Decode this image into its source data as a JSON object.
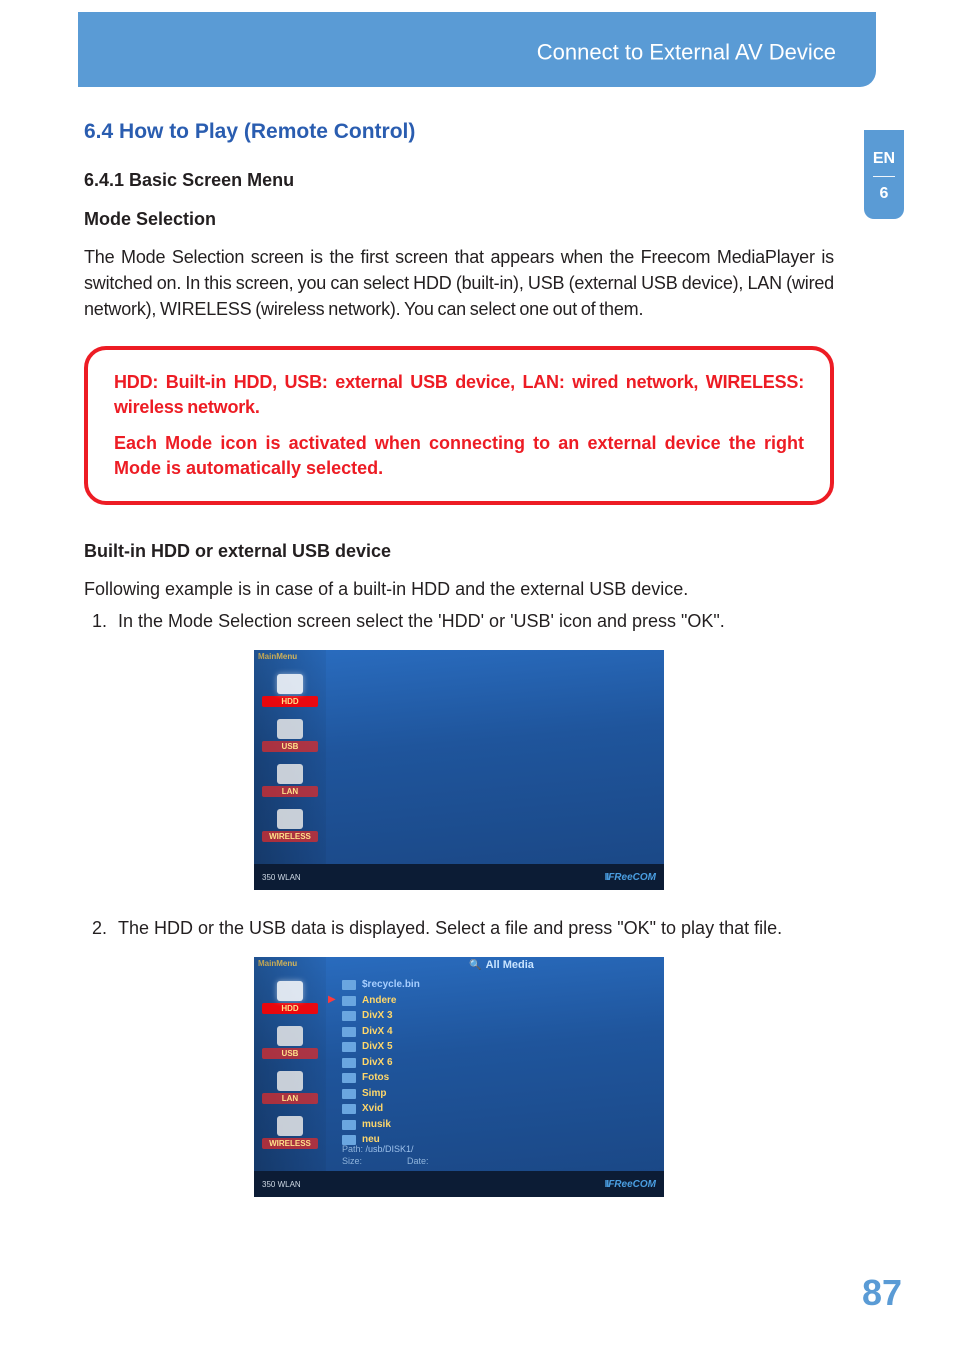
{
  "header": {
    "title": "Connect to External AV Device"
  },
  "sideTab": {
    "lang": "EN",
    "chapter": "6"
  },
  "section": {
    "title": "6.4 How to Play (Remote Control)",
    "sub1": "6.4.1 Basic Screen Menu",
    "sub2": "Mode Selection",
    "para1": "The Mode Selection screen is the first screen that appears when the Freecom MediaPlayer is switched on. In this screen, you can select HDD (built-in), USB (external USB device), LAN (wired network), WIRELESS (wireless network). You can select one out of them."
  },
  "callout": {
    "line1": "HDD: Built-in HDD, USB: external USB device, LAN: wired network, WIRELESS: wireless network.",
    "line2": "Each Mode icon is activated when connecting to an external device the right Mode is automatically selected."
  },
  "section2": {
    "title": "Built-in HDD or external USB device",
    "para": "Following example is in case of a built-in HDD and the external USB device.",
    "steps": [
      "In the Mode Selection screen select the 'HDD' or 'USB' icon and press \"OK\".",
      "The HDD or the USB data is displayed. Select a file and press \"OK\" to play that file."
    ]
  },
  "screenshot1": {
    "mainMenu": "MainMenu",
    "modes": [
      "HDD",
      "USB",
      "LAN",
      "WIRELESS"
    ],
    "device": "350 WLAN",
    "brandBars": "II",
    "brand": "FReeCOM"
  },
  "screenshot2": {
    "mainMenu": "MainMenu",
    "topTitle": "All Media",
    "modes": [
      "HDD",
      "USB",
      "LAN",
      "WIRELESS"
    ],
    "files": [
      "$recycle.bin",
      "Andere",
      "DivX 3",
      "DivX 4",
      "DivX 5",
      "DivX 6",
      "Fotos",
      "Simp",
      "Xvid",
      "musik",
      "neu"
    ],
    "pathLabel": "Path:",
    "pathValue": "/usb/DISK1/",
    "sizeLabel": "Size:",
    "dateLabel": "Date:",
    "device": "350 WLAN",
    "brandBars": "II",
    "brand": "FReeCOM"
  },
  "pageNumber": "87"
}
